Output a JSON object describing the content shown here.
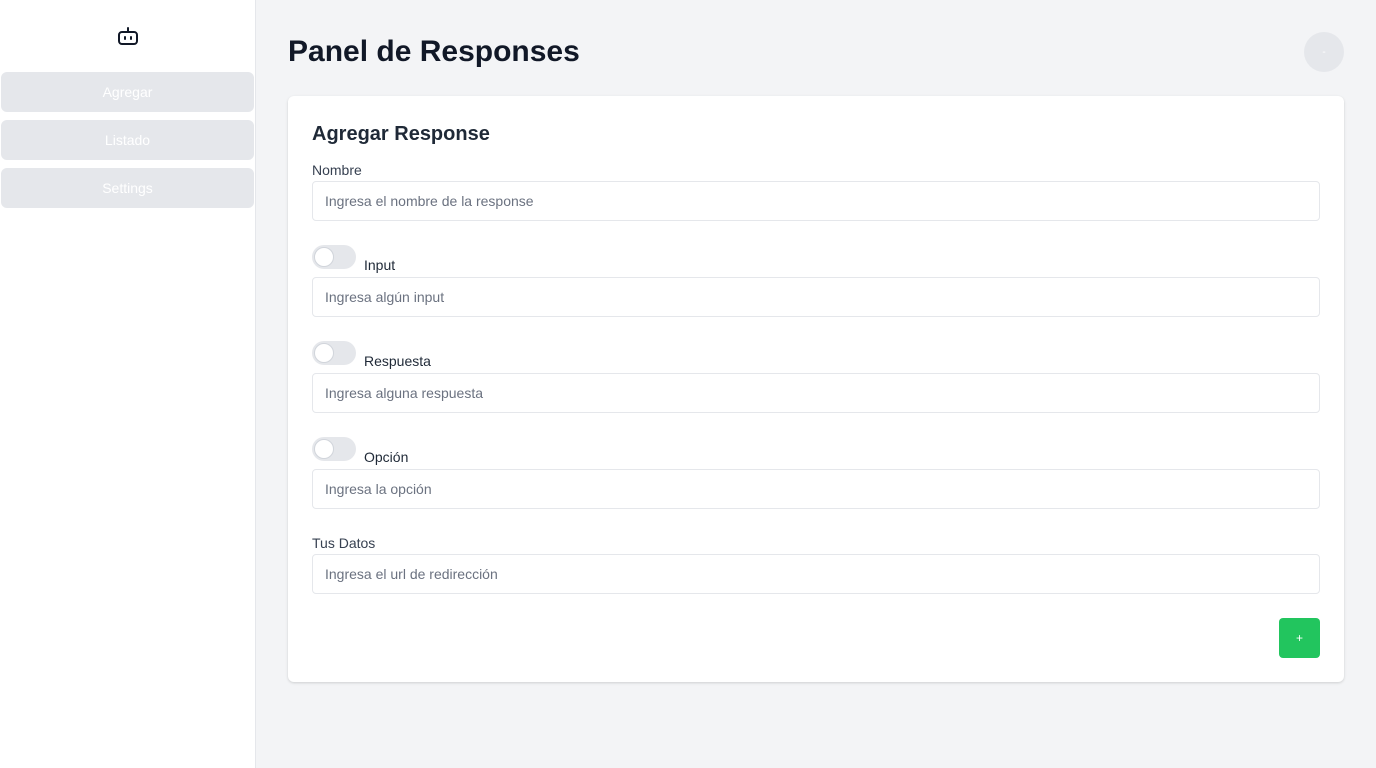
{
  "sidebar": {
    "logo_icon": "robot-icon",
    "items": [
      {
        "label": "Agregar"
      },
      {
        "label": "Listado"
      },
      {
        "label": "Settings"
      }
    ]
  },
  "header": {
    "title": "Panel de Responses",
    "avatar_label": "-"
  },
  "form": {
    "title": "Agregar Response",
    "nombre": {
      "label": "Nombre",
      "placeholder": "Ingresa el nombre de la response",
      "value": ""
    },
    "input": {
      "label": "Input",
      "placeholder": "Ingresa algún input",
      "value": "",
      "toggle_on": false
    },
    "respuesta": {
      "label": "Respuesta",
      "placeholder": "Ingresa alguna respuesta",
      "value": "",
      "toggle_on": false
    },
    "opcion": {
      "label": "Opción",
      "placeholder": "Ingresa la opción",
      "value": "",
      "toggle_on": false
    },
    "tus_datos": {
      "label": "Tus Datos",
      "placeholder": "Ingresa el url de redirección",
      "value": ""
    },
    "submit_label": "+"
  },
  "colors": {
    "accent_green": "#22c55e",
    "sidebar_item_bg": "#e5e7eb",
    "page_bg": "#f3f4f6"
  }
}
